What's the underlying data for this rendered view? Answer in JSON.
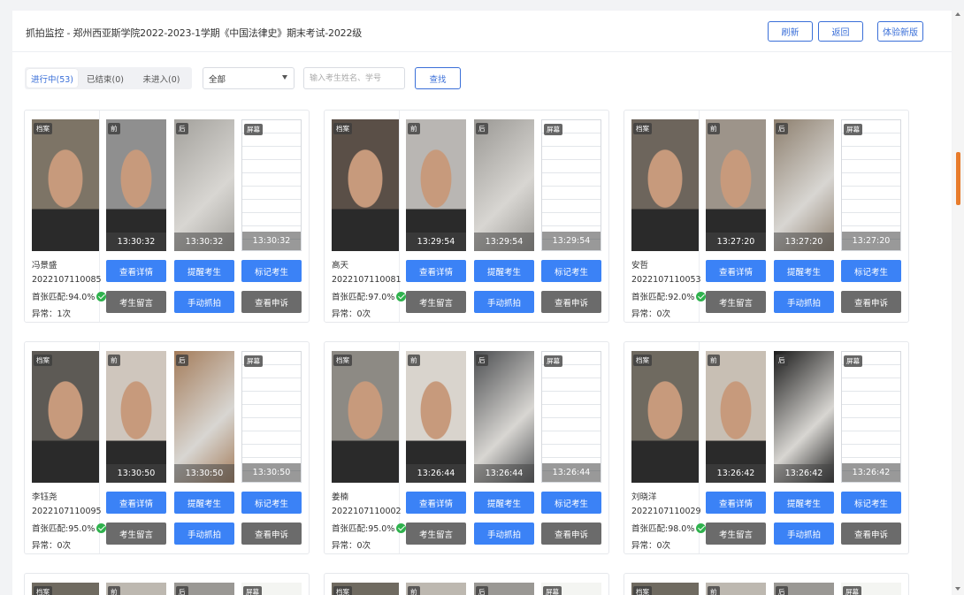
{
  "header": {
    "title": "抓拍监控 - 郑州西亚斯学院2022-2023-1学期《中国法律史》期末考试-2022级",
    "refresh_label": "刷新",
    "back_label": "返回",
    "newui_label": "体验新版"
  },
  "filters": {
    "tabs": [
      "进行中(53)",
      "已结束(0)",
      "未进入(0)"
    ],
    "select_value": "全部",
    "search_placeholder": "输入考生姓名、学号",
    "search_button": "查找"
  },
  "labels": {
    "archive": "档案",
    "front": "前",
    "back": "后",
    "screen": "屏幕",
    "btn_detail": "查看详情",
    "btn_remind": "提醒考生",
    "btn_mark": "标记考生",
    "btn_message": "考生留言",
    "btn_capture": "手动抓拍",
    "btn_appeal": "查看申诉"
  },
  "students": [
    {
      "name": "冯景盛",
      "id": "2022107110085",
      "match": "首张匹配:94.0%",
      "abnormal": "异常：1次",
      "time": "13:30:32"
    },
    {
      "name": "高天",
      "id": "2022107110081",
      "match": "首张匹配:97.0%",
      "abnormal": "异常：0次",
      "time": "13:29:54"
    },
    {
      "name": "安哲",
      "id": "2022107110053",
      "match": "首张匹配:92.0%",
      "abnormal": "异常：0次",
      "time": "13:27:20"
    },
    {
      "name": "李钰尧",
      "id": "2022107110095",
      "match": "首张匹配:95.0%",
      "abnormal": "异常：0次",
      "time": "13:30:50"
    },
    {
      "name": "姜楠",
      "id": "2022107110002",
      "match": "首张匹配:95.0%",
      "abnormal": "异常：0次",
      "time": "13:26:44"
    },
    {
      "name": "刘晓洋",
      "id": "2022107110029",
      "match": "首张匹配:98.0%",
      "abnormal": "异常：0次",
      "time": "13:26:42"
    }
  ],
  "colors": {
    "accent": "#3b82f6",
    "gray_button": "#6b6b6b",
    "ok_green": "#2fb24d",
    "scroll_thumb": "#e87c2c"
  }
}
